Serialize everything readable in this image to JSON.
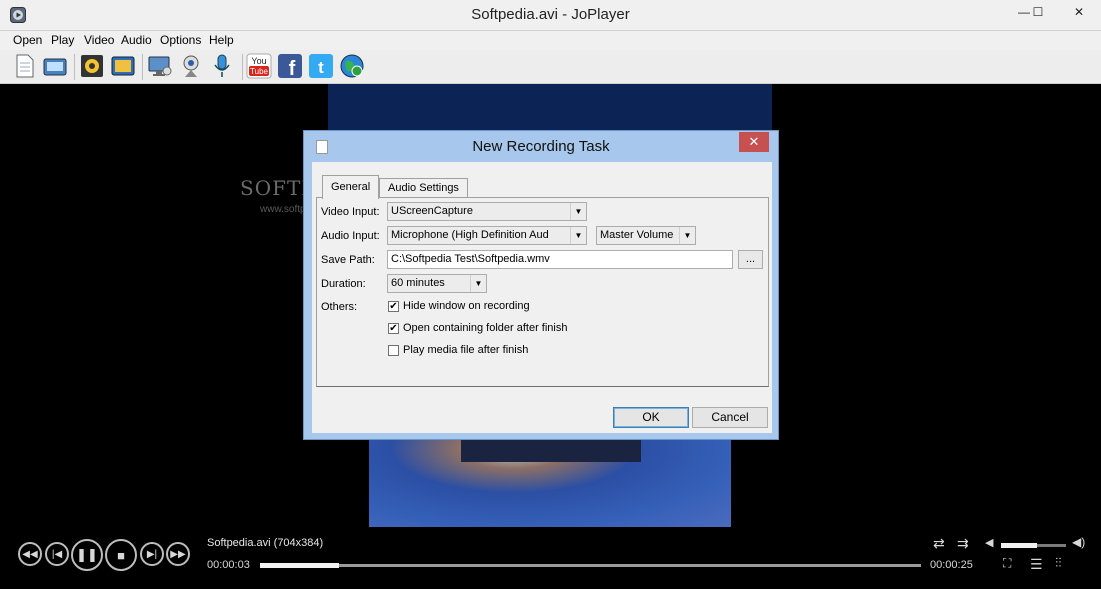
{
  "window": {
    "title": "Softpedia.avi - JoPlayer",
    "minimize": "—",
    "maximize": "☐",
    "close": "✕"
  },
  "menu": [
    "Open",
    "Play",
    "Video",
    "Audio",
    "Options",
    "Help"
  ],
  "toolbar": {
    "icons": [
      "open-file-icon",
      "open-dvd-icon",
      "capture-icon",
      "snapshot-icon",
      "screen-record-icon",
      "webcam-icon",
      "microphone-icon",
      "youtube-icon",
      "facebook-icon",
      "twitter-icon",
      "web-icon"
    ],
    "youtube_label": "You\nTube"
  },
  "video": {
    "watermark": "SOFTPE",
    "watermark_url": "www.softpe"
  },
  "player": {
    "file_label": "Softpedia.avi (704x384)",
    "elapsed": "00:00:03",
    "total": "00:00:25",
    "progress": 0.12,
    "volume": 0.55
  },
  "dialog": {
    "title": "New Recording Task",
    "close": "✕",
    "tabs": [
      {
        "label": "General",
        "active": true
      },
      {
        "label": "Audio Settings",
        "active": false
      }
    ],
    "video_input": {
      "label": "Video Input:",
      "value": "UScreenCapture"
    },
    "audio_input": {
      "label": "Audio Input:",
      "value": "Microphone (High Definition Aud",
      "volume_value": "Master Volume"
    },
    "save_path": {
      "label": "Save Path:",
      "value": "C:\\Softpedia Test\\Softpedia.wmv",
      "browse": "..."
    },
    "duration": {
      "label": "Duration:",
      "value": "60 minutes"
    },
    "others": {
      "label": "Others:",
      "options": [
        {
          "label": "Hide window on recording",
          "checked": true
        },
        {
          "label": "Open containing folder after finish",
          "checked": true
        },
        {
          "label": "Play media file after finish",
          "checked": false
        }
      ]
    },
    "ok": "OK",
    "cancel": "Cancel"
  },
  "colors": {
    "dialog_frame": "#a7c8ec",
    "close_red": "#c75050",
    "video_bg": "#000000"
  }
}
